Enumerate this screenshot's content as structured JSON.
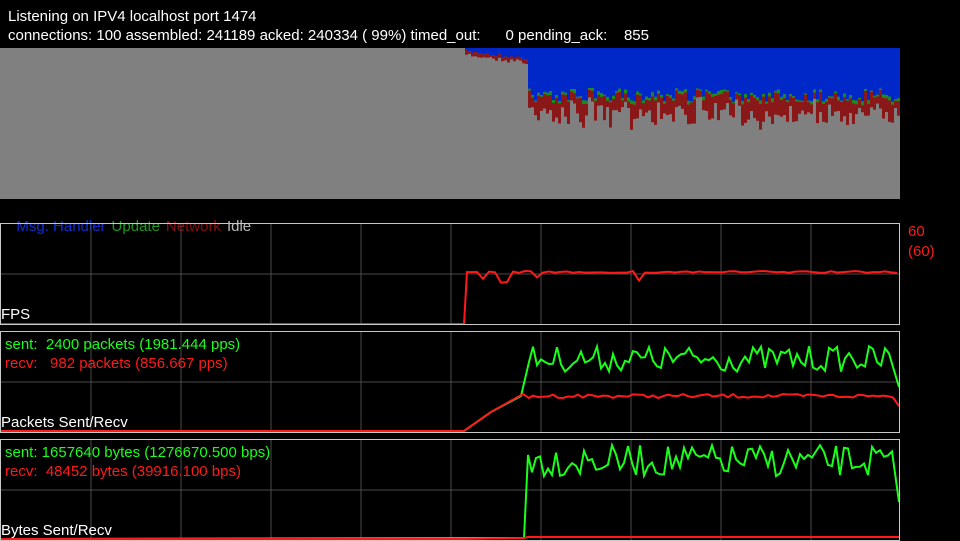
{
  "header": {
    "line1": "Listening on IPV4 localhost port 1474",
    "line2": "connections: 100 assembled: 241189 acked: 240334 ( 99%) timed_out:      0 pending_ack:    855"
  },
  "legend": {
    "items": [
      {
        "label": "Msg. Handler",
        "color": "#1030d0"
      },
      {
        "label": "Update",
        "color": "#1a9a1a"
      },
      {
        "label": "Network",
        "color": "#8b1010"
      },
      {
        "label": "Idle",
        "color": "#b8b8b8"
      }
    ]
  },
  "colors": {
    "grid": "#4a4a4a",
    "border": "#c8c8c8",
    "idle": "#808080",
    "msg": "#0028c8",
    "update": "#1a8a1a",
    "network": "#8b1818",
    "green": "#1aff1a",
    "red": "#ff1a1a"
  },
  "fps": {
    "title": "FPS",
    "max_label": "60",
    "max_paren": "(60)"
  },
  "packets": {
    "title": "Packets Sent/Recv",
    "sent_label": "sent:  2400 packets (1981.444 pps)",
    "recv_label": "recv:   982 packets (856.667 pps)"
  },
  "bytes": {
    "title": "Bytes Sent/Recv",
    "sent_label": "sent: 1657640 bytes (1276670.500 bps)",
    "recv_label": "recv:  48452 bytes (39916.100 bps)"
  }
}
